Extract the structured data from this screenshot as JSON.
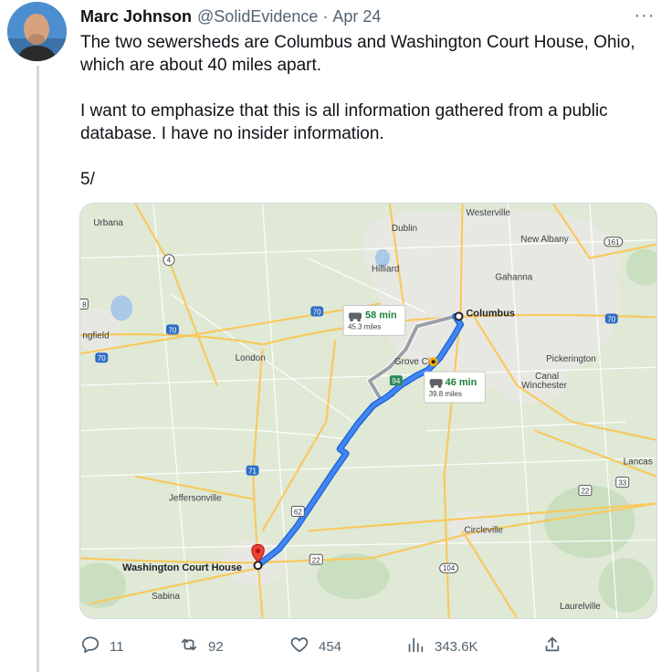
{
  "tweet": {
    "author_name": "Marc Johnson",
    "author_handle": "@SolidEvidence",
    "separator": "·",
    "date": "Apr 24",
    "more_label": "···",
    "paragraphs": [
      "The two sewersheds are Columbus and Washington Court House, Ohio, which are about 40 miles apart.",
      "I want to emphasize that this is all information gathered from a public database. I have no insider information.",
      "5/"
    ]
  },
  "map": {
    "places": {
      "urbana": "Urbana",
      "dublin": "Dublin",
      "westerville": "Westerville",
      "new_albany": "New Albany",
      "hilliard": "Hilliard",
      "gahanna": "Gahanna",
      "columbus": "Columbus",
      "springfield": "ngfield",
      "london": "London",
      "grove_city": "Grove Ci",
      "pickerington": "Pickerington",
      "canal_winchester_1": "Canal",
      "canal_winchester_2": "Winchester",
      "lancaster": "Lancas",
      "jeffersonville": "Jeffersonville",
      "circleville": "Circleville",
      "washington_ch": "Washington Court House",
      "sabina": "Sabina",
      "laurelville": "Laurelville"
    },
    "shields": {
      "r4": "4",
      "r161": "161",
      "i70a": "70",
      "i70b": "70",
      "i70c": "70",
      "i70d": "70",
      "r94": "94",
      "i71": "71",
      "r62": "62",
      "r22a": "22",
      "r22b": "22",
      "r33": "33",
      "r104": "104",
      "r8": "8"
    },
    "route_alt": {
      "time": "58 min",
      "distance": "45.3 miles"
    },
    "route_main": {
      "time": "46 min",
      "distance": "39.8 miles"
    },
    "colors": {
      "route": "#4285f4",
      "route_alt": "#9aa0a6",
      "time_text": "#188038",
      "pin": "#ea4335",
      "land": "#dfe9d6",
      "urban": "#e8e8e3",
      "road": "#f8c95e"
    }
  },
  "actions": {
    "reply": {
      "icon": "reply-icon",
      "count": "11"
    },
    "retweet": {
      "icon": "retweet-icon",
      "count": "92"
    },
    "like": {
      "icon": "heart-icon",
      "count": "454"
    },
    "views": {
      "icon": "bar-chart-icon",
      "count": "343.6K"
    },
    "share": {
      "icon": "share-icon"
    }
  }
}
